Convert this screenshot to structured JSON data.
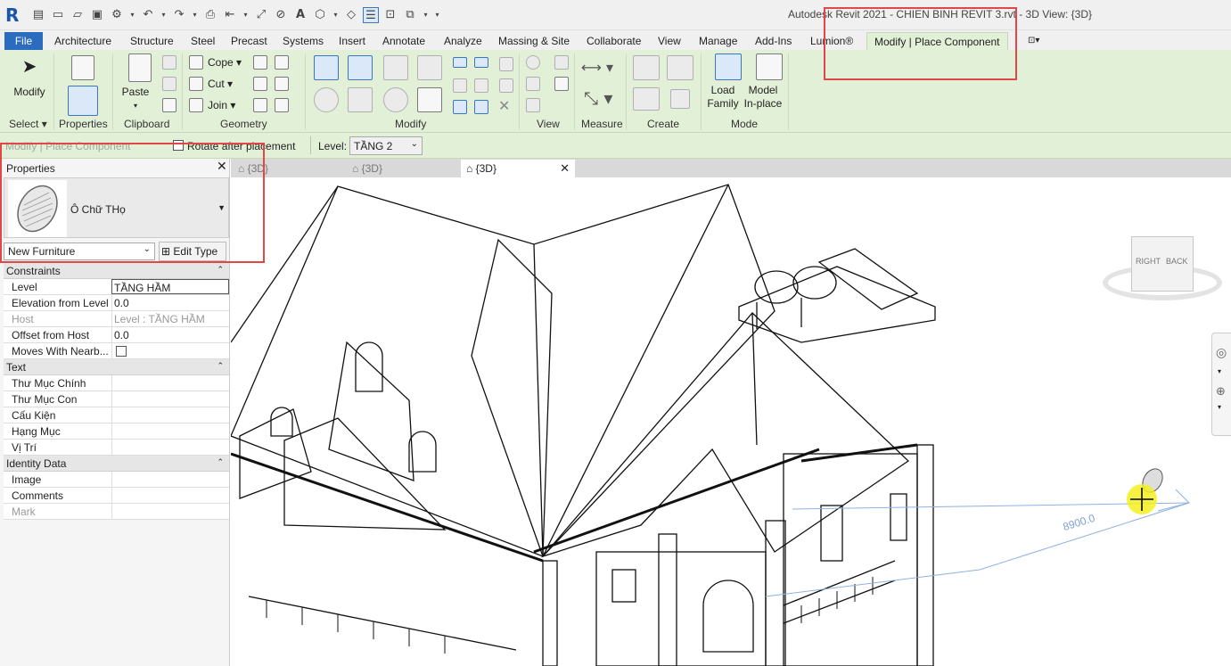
{
  "app": {
    "title": "Autodesk Revit 2021 - CHIEN BINH REVIT 3.rvt - 3D View: {3D}",
    "logo": "R"
  },
  "ribbon_tabs": [
    "File",
    "Architecture",
    "Structure",
    "Steel",
    "Precast",
    "Systems",
    "Insert",
    "Annotate",
    "Analyze",
    "Massing & Site",
    "Collaborate",
    "View",
    "Manage",
    "Add-Ins",
    "Lumion®",
    "Modify | Place Component"
  ],
  "ribbon": {
    "modify": "Modify",
    "select": "Select",
    "properties": "Properties",
    "paste": "Paste",
    "clipboard": "Clipboard",
    "cope": "Cope",
    "cut": "Cut",
    "join": "Join",
    "geometry": "Geometry",
    "modify_panel": "Modify",
    "view_panel": "View",
    "measure_panel": "Measure",
    "create_panel": "Create",
    "load_family_1": "Load",
    "load_family_2": "Family",
    "model_inplace_1": "Model",
    "model_inplace_2": "In-place",
    "mode_panel": "Mode"
  },
  "options_bar": {
    "context": "Modify | Place Component",
    "rotate": "Rotate after placement",
    "level_label": "Level:",
    "level_value": "TẦNG 2"
  },
  "properties": {
    "title": "Properties",
    "family_name": "Ô Chữ THọ",
    "type_selector": "New Furniture",
    "edit_type": "Edit Type",
    "sections": [
      {
        "name": "Constraints",
        "rows": [
          {
            "key": "Level",
            "value": "TẦNG HẦM"
          },
          {
            "key": "Elevation from Level",
            "value": "0.0"
          },
          {
            "key": "Host",
            "value": "Level : TẦNG HẦM"
          },
          {
            "key": "Offset from Host",
            "value": "0.0"
          },
          {
            "key": "Moves With Nearb...",
            "value": ""
          }
        ]
      },
      {
        "name": "Text",
        "rows": [
          {
            "key": "Thư Mục Chính",
            "value": ""
          },
          {
            "key": "Thư Mục Con",
            "value": ""
          },
          {
            "key": "Cấu Kiện",
            "value": ""
          },
          {
            "key": "Hạng Mục",
            "value": ""
          },
          {
            "key": "Vị Trí",
            "value": ""
          }
        ]
      },
      {
        "name": "Identity Data",
        "rows": [
          {
            "key": "Image",
            "value": ""
          },
          {
            "key": "Comments",
            "value": ""
          },
          {
            "key": "Mark",
            "value": ""
          }
        ]
      }
    ]
  },
  "doc_tabs": [
    "{3D}",
    "{3D}",
    "{3D}"
  ],
  "viewcube": {
    "right": "RIGHT",
    "back": "BACK"
  },
  "dimension_text": "8900.0",
  "colors": {
    "file_tab": "#2b6cbf",
    "ribbon_bg": "#e3f0d8",
    "highlight": "#e04848",
    "cursor": "#f5f020"
  }
}
